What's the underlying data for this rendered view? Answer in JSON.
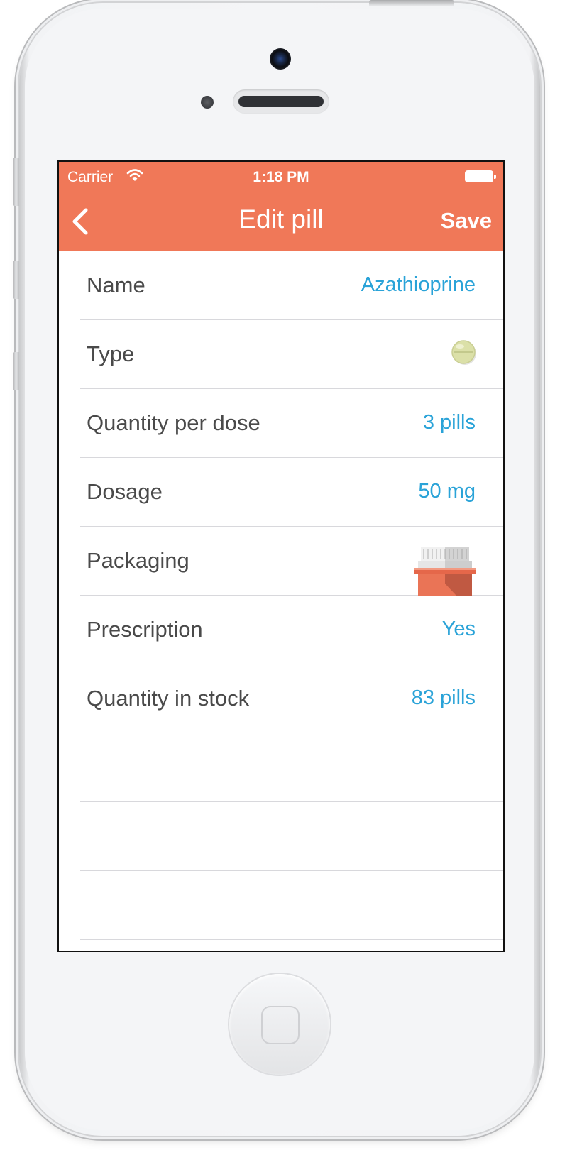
{
  "colors": {
    "accent": "#f07858",
    "value_text": "#2aa3d8",
    "label_text": "#4a4a4a",
    "separator": "#d8d8dc"
  },
  "status_bar": {
    "carrier": "Carrier",
    "time": "1:18 PM",
    "wifi_icon": "wifi-icon",
    "battery_icon": "battery-icon"
  },
  "nav_bar": {
    "back_icon": "chevron-left-icon",
    "title": "Edit pill",
    "save_label": "Save"
  },
  "rows": [
    {
      "label": "Name",
      "value": "Azathioprine"
    },
    {
      "label": "Type",
      "icon": "round-pill-icon"
    },
    {
      "label": "Quantity per dose",
      "value": "3 pills"
    },
    {
      "label": "Dosage",
      "value": "50 mg"
    },
    {
      "label": "Packaging",
      "icon": "pill-bottle-icon"
    },
    {
      "label": "Prescription",
      "value": "Yes"
    },
    {
      "label": "Quantity in stock",
      "value": "83 pills"
    }
  ],
  "device": {
    "home_button_icon": "home-button-icon"
  }
}
